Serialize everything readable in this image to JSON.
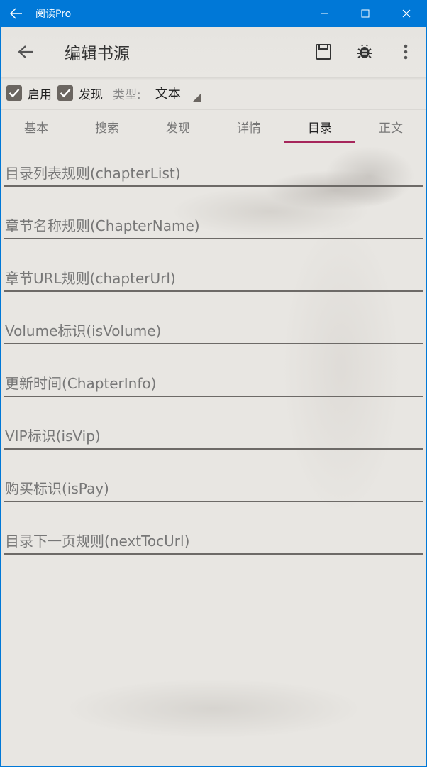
{
  "window": {
    "title": "阅读Pro",
    "back_icon": "arrow-left-icon",
    "controls": [
      "minimize-icon",
      "maximize-icon",
      "close-icon"
    ]
  },
  "toolbar": {
    "title": "编辑书源",
    "back_icon": "arrow-left-icon",
    "actions": [
      "save-icon",
      "bug-icon",
      "more-vertical-icon"
    ]
  },
  "options": {
    "enabled": {
      "label": "启用",
      "checked": true
    },
    "discover": {
      "label": "发现",
      "checked": true
    },
    "type_label": "类型:",
    "type_value": "文本"
  },
  "tabs": [
    {
      "label": "基本",
      "active": false
    },
    {
      "label": "搜索",
      "active": false
    },
    {
      "label": "发现",
      "active": false
    },
    {
      "label": "详情",
      "active": false
    },
    {
      "label": "目录",
      "active": true
    },
    {
      "label": "正文",
      "active": false
    }
  ],
  "fields": [
    {
      "placeholder": "目录列表规则(chapterList)",
      "value": ""
    },
    {
      "placeholder": "章节名称规则(ChapterName)",
      "value": ""
    },
    {
      "placeholder": "章节URL规则(chapterUrl)",
      "value": ""
    },
    {
      "placeholder": "Volume标识(isVolume)",
      "value": ""
    },
    {
      "placeholder": "更新时间(ChapterInfo)",
      "value": ""
    },
    {
      "placeholder": "VIP标识(isVip)",
      "value": ""
    },
    {
      "placeholder": "购买标识(isPay)",
      "value": ""
    },
    {
      "placeholder": "目录下一页规则(nextTocUrl)",
      "value": ""
    }
  ],
  "colors": {
    "titlebar": "#0078d7",
    "accent": "#a6265b",
    "background": "#e8e6e2",
    "checkbox": "#6b6661"
  }
}
